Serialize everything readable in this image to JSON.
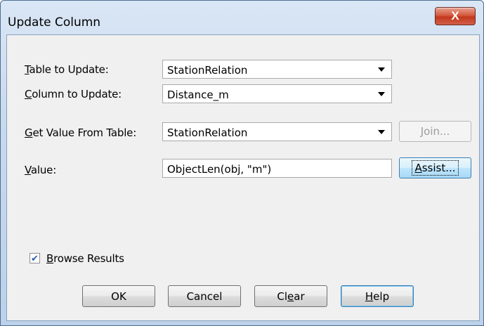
{
  "window": {
    "title": "Update Column",
    "close_label": "X"
  },
  "form": {
    "table_to_update": {
      "label_key": "T",
      "label_rest": "able to Update:",
      "value": "StationRelation"
    },
    "column_to_update": {
      "label_key": "C",
      "label_rest": "olumn to Update:",
      "value": "Distance_m"
    },
    "get_value_from_table": {
      "label_key": "G",
      "label_rest": "et Value From Table:",
      "value": "StationRelation"
    },
    "value": {
      "label_key": "V",
      "label_rest": "alue:",
      "value": "ObjectLen(obj, \"m\")"
    }
  },
  "buttons": {
    "join": {
      "key": "J",
      "rest": "oin..."
    },
    "assist": {
      "key": "A",
      "rest": "ssist..."
    },
    "ok": "OK",
    "cancel": "Cancel",
    "clear": {
      "pre": "Cl",
      "key": "e",
      "rest": "ar"
    },
    "help": {
      "key": "H",
      "rest": "elp"
    }
  },
  "browse_results": {
    "key": "B",
    "rest": "rowse Results",
    "checked": true
  },
  "colors": {
    "close_red": "#c3381d",
    "title_bg": "#c7d9ee",
    "client_bg": "#f0f0f0"
  }
}
